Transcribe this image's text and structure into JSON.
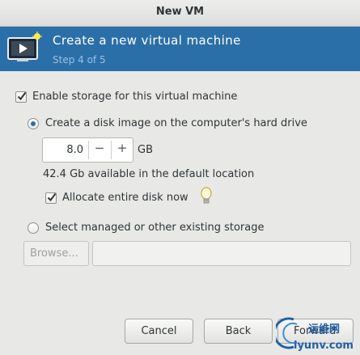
{
  "window": {
    "title": "New VM"
  },
  "banner": {
    "heading": "Create a new virtual machine",
    "step": "Step 4 of 5"
  },
  "storage": {
    "enable_label": "Enable storage for this virtual machine",
    "enable_checked": true,
    "create_label": "Create a disk image on the computer's hard drive",
    "create_selected": true,
    "size_value": "8.0",
    "minus": "−",
    "plus": "+",
    "unit": "GB",
    "available": "42.4 Gb available in the default location",
    "allocate_label": "Allocate entire disk now",
    "allocate_checked": true,
    "hint_icon": "lightbulb-icon",
    "managed_label": "Select managed or other existing storage",
    "managed_selected": false,
    "browse_label": "Browse...",
    "path_value": ""
  },
  "buttons": {
    "cancel": "Cancel",
    "back": "Back",
    "forward": "Forward"
  },
  "watermark": {
    "text_top": "运维网",
    "text_bottom": "iyunv.com"
  },
  "colors": {
    "banner_bg": "#2b6fa8",
    "step_text": "#9bc0e0",
    "window_bg": "#e8e8e7"
  }
}
